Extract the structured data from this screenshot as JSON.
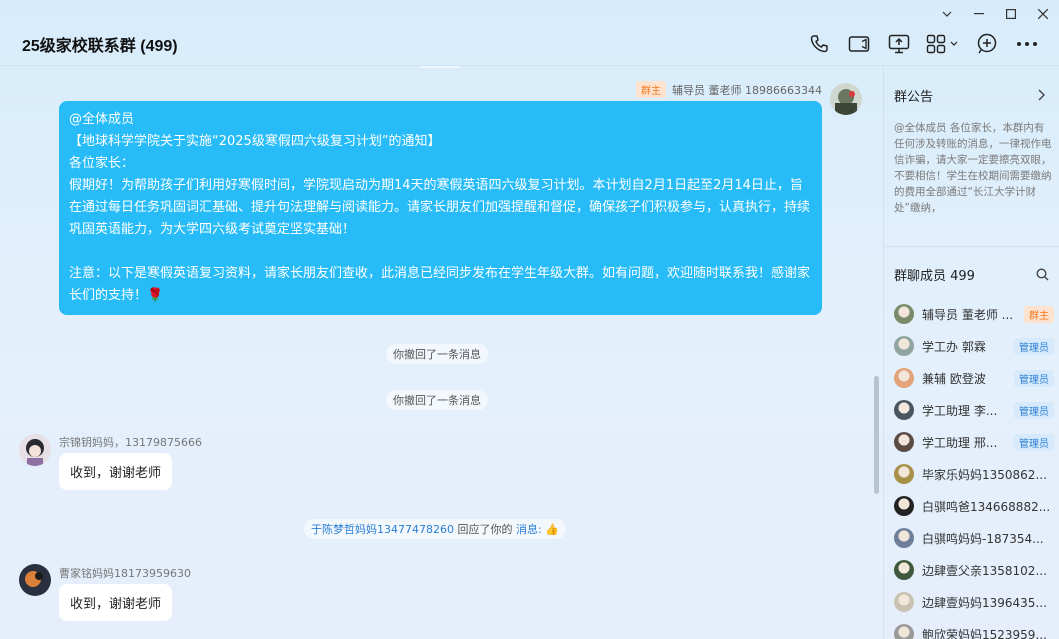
{
  "window": {
    "title": "25级家校联系群 (499)",
    "controls": [
      "chevron-down-icon",
      "minimize-icon",
      "maximize-icon",
      "close-icon"
    ]
  },
  "toolbar": [
    "phone-icon",
    "video-icon",
    "screen-share-icon",
    "apps-icon",
    "add-member-icon",
    "more-icon"
  ],
  "messages": {
    "self": {
      "badge": "群主",
      "sender": "辅导员 董老师 18986663344",
      "lines": [
        "@全体成员",
        "【地球科学学院关于实施“2025级寒假四六级复习计划”的通知】",
        "各位家长：",
        "假期好！为帮助孩子们利用好寒假时间，学院现启动为期14天的寒假英语四六级复习计划。本计划自2月1日起至2月14日止，旨在通过每日任务巩固词汇基础、提升句法理解与阅读能力。请家长朋友们加强提醒和督促，确保孩子们积极参与，认真执行，持续巩固英语能力，为大学四六级考试奠定坚实基础！",
        "",
        "注意：以下是寒假英语复习资料，请家长朋友们查收，此消息已经同步发布在学生年级大群。如有问题，欢迎随时联系我！感谢家长们的支持！🌹"
      ]
    },
    "recall_1": "你撤回了一条消息",
    "recall_2": "你撤回了一条消息",
    "msg1": {
      "sender": "宗锦钥妈妈，13179875666",
      "text": "收到，谢谢老师"
    },
    "reply_notice": {
      "name": "于陈梦哲妈妈13477478260",
      "action": "回应了你的",
      "target": "消息:",
      "emoji": "👍"
    },
    "msg2": {
      "sender": "曹家铭妈妈18173959630",
      "text": "收到，谢谢老师"
    }
  },
  "sidebar": {
    "notice_title": "群公告",
    "notice_text": "@全体成员 各位家长，本群内有任何涉及转账的消息，一律视作电信诈骗，请大家一定要擦亮双眼，不要相信！学生在校期间需要缴纳的费用全部通过“长江大学计财处”缴纳，",
    "members_title": "群聊成员 499",
    "members": [
      {
        "name": "辅导员 董老师 ...",
        "badge": "群主",
        "badge_type": "owner",
        "color": "#7a8a6a"
      },
      {
        "name": "学工办 郭霖",
        "badge": "管理员",
        "badge_type": "admin",
        "color": "#8fa5a0"
      },
      {
        "name": "兼辅 欧登波",
        "badge": "管理员",
        "badge_type": "admin",
        "color": "#e2a27a"
      },
      {
        "name": "学工助理 李...",
        "badge": "管理员",
        "badge_type": "admin",
        "color": "#4a5560"
      },
      {
        "name": "学工助理 邢...",
        "badge": "管理员",
        "badge_type": "admin",
        "color": "#5a4b45"
      },
      {
        "name": "毕家乐妈妈1350862...",
        "badge": "",
        "badge_type": "",
        "color": "#a88f4a"
      },
      {
        "name": "白骐鸣爸134668882...",
        "badge": "",
        "badge_type": "",
        "color": "#222222"
      },
      {
        "name": "白骐鸣妈妈-187354...",
        "badge": "",
        "badge_type": "",
        "color": "#6d7f9a"
      },
      {
        "name": "边肆壹父亲1358102...",
        "badge": "",
        "badge_type": "",
        "color": "#3e5a3a"
      },
      {
        "name": "边肆壹妈妈1396435...",
        "badge": "",
        "badge_type": "",
        "color": "#c9c2b0"
      },
      {
        "name": "鲍欣荣妈妈1523959...",
        "badge": "",
        "badge_type": "",
        "color": "#9a9a9a"
      }
    ]
  }
}
